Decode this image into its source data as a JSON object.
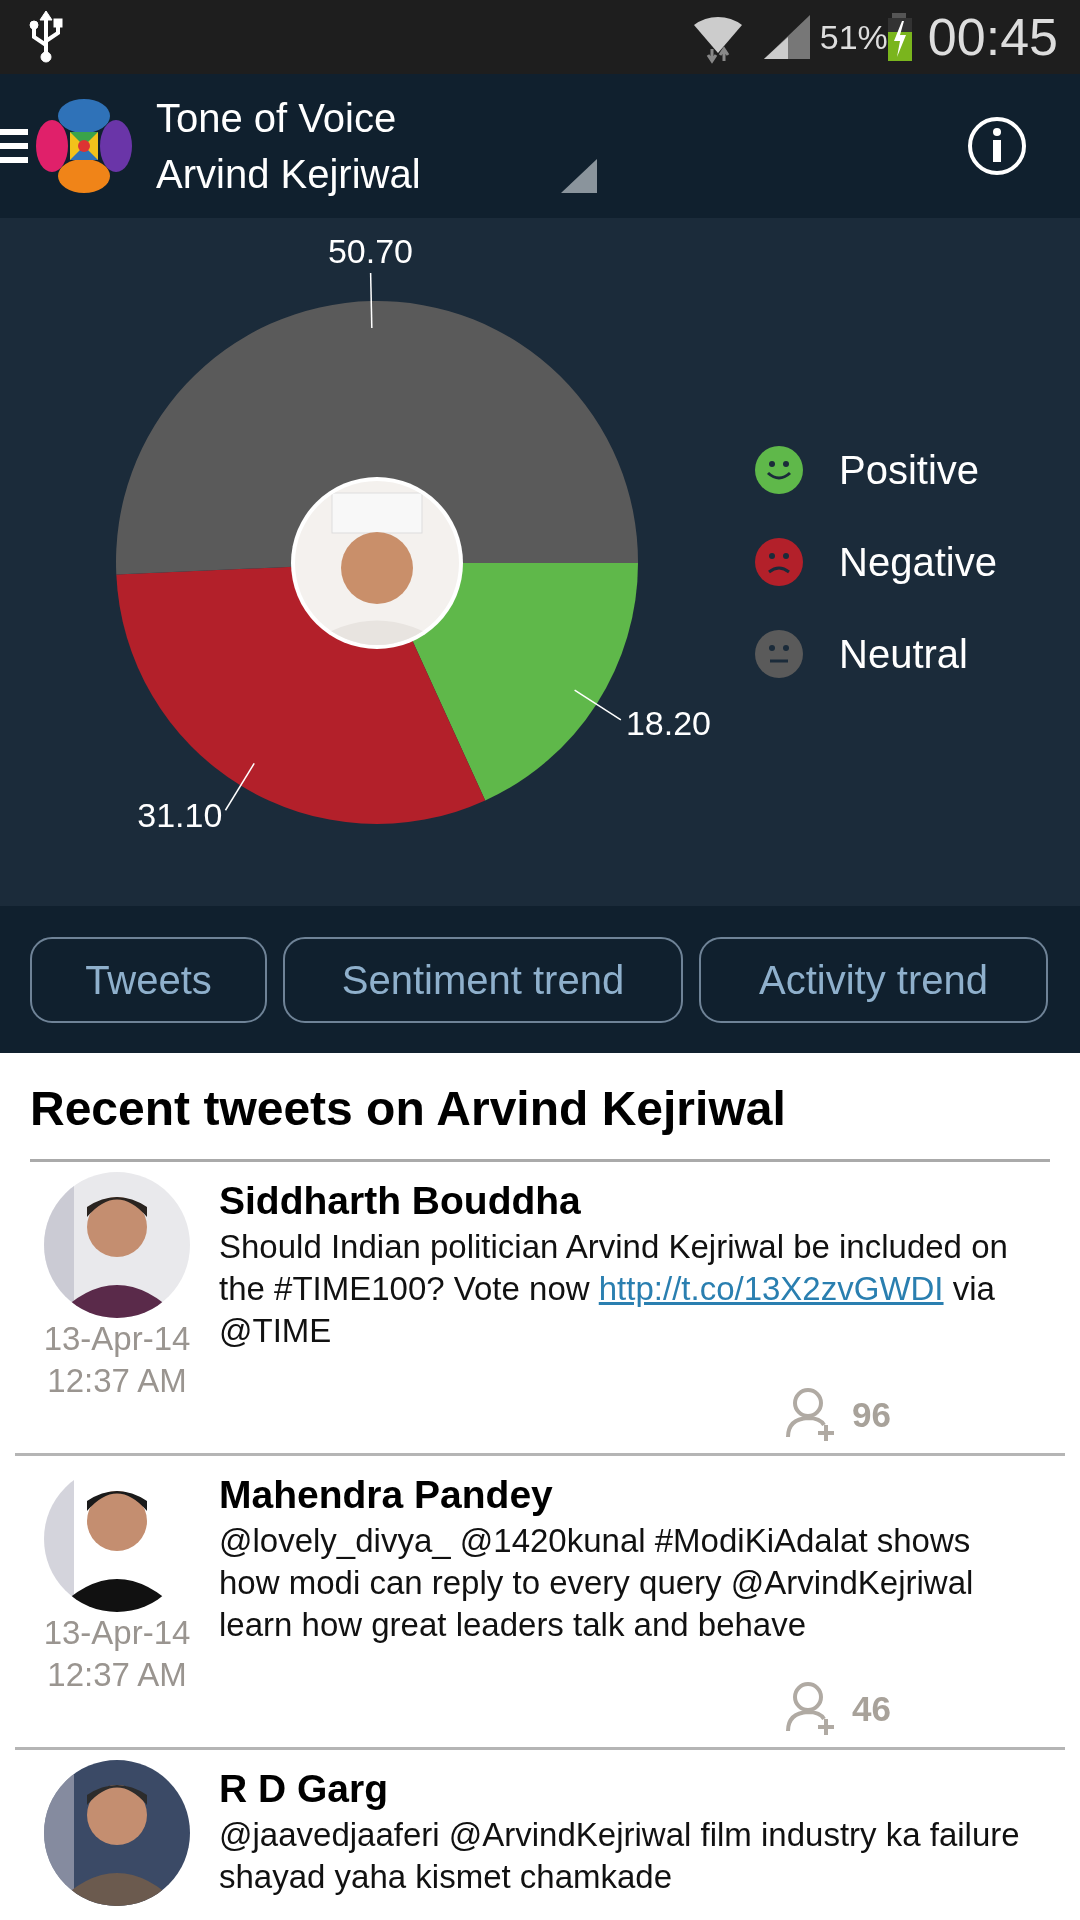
{
  "status_bar": {
    "battery": "51%",
    "time": "00:45"
  },
  "header": {
    "title": "Tone of Voice",
    "subtitle": "Arvind Kejriwal"
  },
  "chart": {
    "chart_data": {
      "type": "donut",
      "categories": [
        "Positive",
        "Negative",
        "Neutral"
      ],
      "values": [
        18.2,
        31.1,
        50.7
      ],
      "value_labels": [
        "18.20",
        "31.10",
        "50.70"
      ]
    },
    "legend": [
      {
        "color": "#5fb84a",
        "kind": "happy"
      },
      {
        "color": "#b3202a",
        "kind": "sad"
      },
      {
        "color": "#5a5a5a",
        "kind": "neutral"
      }
    ]
  },
  "buttons": [
    "Tweets",
    "Sentiment trend",
    "Activity trend"
  ],
  "tweets": {
    "heading": "Recent tweets on Arvind Kejriwal",
    "items": [
      {
        "name": "Siddharth Bouddha",
        "segments": [
          {
            "kind": "text",
            "text": "Should Indian politician Arvind Kejriwal be included on the #TIME100? Vote now "
          },
          {
            "kind": "link",
            "text": "http://t.co/13X2zvGWDI"
          },
          {
            "kind": "text",
            "text": " via @TIME"
          }
        ],
        "date": "13-Apr-14",
        "time": "12:37 AM",
        "followers": "96"
      },
      {
        "name": "Mahendra Pandey",
        "segments": [
          {
            "kind": "text",
            "text": "@lovely_divya_ @1420kunal #ModiKiAdalat shows how modi can reply to every query @ArvindKejriwal learn how great leaders talk and behave"
          }
        ],
        "date": "13-Apr-14",
        "time": "12:37 AM",
        "followers": "46"
      },
      {
        "name": "R D Garg",
        "segments": [
          {
            "kind": "text",
            "text": "@jaavedjaaferi @ArvindKejriwal film industry ka failure shayad yaha kismet chamkade"
          }
        ]
      }
    ]
  }
}
